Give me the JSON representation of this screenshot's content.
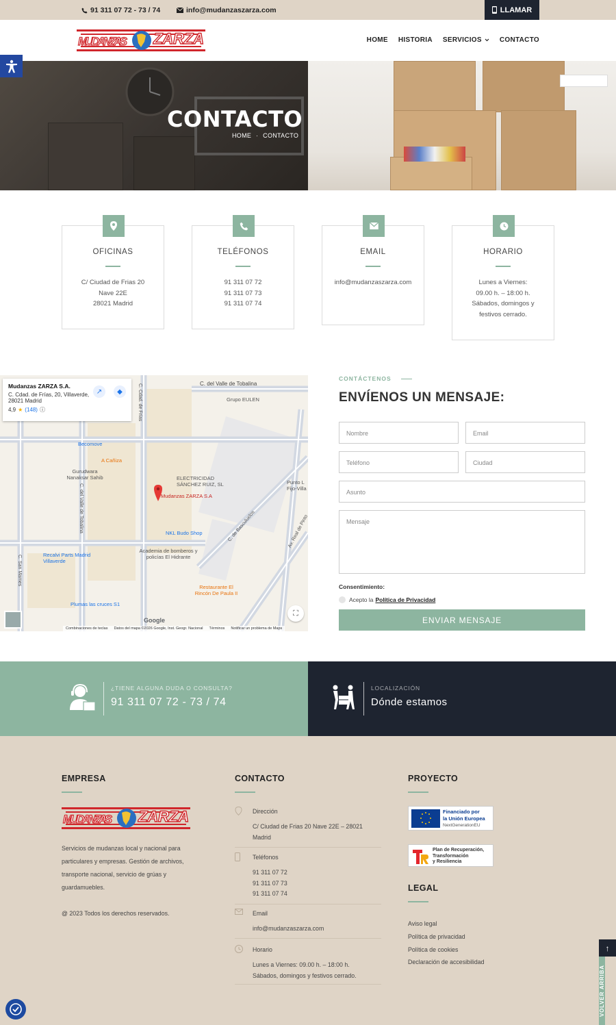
{
  "topbar": {
    "phone": "91 311 07 72 - 73 / 74",
    "email": "info@mudanzaszarza.com",
    "call_label": "LLAMAR"
  },
  "header": {
    "logo_text_left": "MUDANZAS",
    "logo_text_right": "ZARZA",
    "nav": [
      "HOME",
      "HISTORIA",
      "SERVICIOS",
      "CONTACTO"
    ]
  },
  "hero": {
    "title": "CONTACTO",
    "crumb_home": "HOME",
    "crumb_sep": "·",
    "crumb_current": "CONTACTO"
  },
  "cards": [
    {
      "icon": "location-icon",
      "title": "OFICINAS",
      "lines": [
        "C/ Ciudad de Frias 20",
        "Nave 22E",
        "28021 Madrid"
      ]
    },
    {
      "icon": "phone-icon",
      "title": "TELÉFONOS",
      "lines": [
        "91 311 07 72",
        "91 311 07 73",
        "91 311 07 74"
      ]
    },
    {
      "icon": "email-icon",
      "title": "EMAIL",
      "lines": [
        "info@mudanzaszarza.com"
      ]
    },
    {
      "icon": "clock-icon",
      "title": "HORARIO",
      "lines": [
        "Lunes a Viernes:",
        "09.00 h. – 18:00 h.",
        "Sábados, domingos y",
        "festivos cerrado."
      ]
    }
  ],
  "map": {
    "place_name": "Mudanzas ZARZA S.A.",
    "address_1": "C. Cdad. de Frías, 20, Villaverde,",
    "address_2": "28021 Madrid",
    "rating": "4,9",
    "reviews": "(148)",
    "labels": [
      "C. del Valle de Tobalina",
      "Grupo EULEN",
      "Becomove",
      "A Cañiza",
      "Gurudwara Nanaksar Sahib",
      "ELECTRICIDAD SÁNCHEZ RUIZ, SL",
      "Mudanzas ZARZA S.A",
      "NKL Budo Shop",
      "Academia de bomberos y policías El Hidrante",
      "Recalvi Parts Madrid Villaverde",
      "Restaurante El Rincón De Paula II",
      "Plumas las cruces S1",
      "C. San Mames",
      "C. Cdad. de Frías",
      "C. del Valle de Tobalina",
      "C. de Basculuelos",
      "Av. Real de Pinto",
      "Punto L Fijo-Villa"
    ],
    "footer": [
      "Combinaciones de teclas",
      "Datos del mapa ©2026 Google, Inst. Geogr. Nacional",
      "Términos",
      "Notificar un problema de Maps"
    ],
    "google": "Google"
  },
  "form": {
    "kicker": "CONTÁCTENOS",
    "title": "ENVÍENOS UN MENSAJE:",
    "placeholders": {
      "name": "Nombre",
      "email": "Email",
      "phone": "Teléfono",
      "city": "Ciudad",
      "subject": "Asunto",
      "message": "Mensaje"
    },
    "consent_label": "Consentimiento:",
    "accept_text": "Acepto la",
    "privacy_link": "Política de Privacidad",
    "submit": "ENVIAR MENSAJE"
  },
  "cta": {
    "left_kicker": "¿TIENE ALGUNA DUDA O CONSULTA?",
    "left_text": "91 311 07 72 - 73 / 74",
    "right_kicker": "LOCALIZACIÓN",
    "right_text": "Dónde estamos"
  },
  "footer": {
    "empresa_title": "EMPRESA",
    "empresa_text": "Servicios de mudanzas local y nacional para particulares y empresas.  Gestión de archivos, transporte nacional, servicio de grúas y guardamuebles.",
    "copyright": "@ 2023 Todos los derechos reservados.",
    "contacto_title": "CONTACTO",
    "contact_items": [
      {
        "label": "Dirección",
        "value": "C/ Ciudad de Frias 20 Nave 22E – 28021 Madrid"
      },
      {
        "label": "Teléfonos",
        "value": "91 311 07 72\n91 311 07 73\n91 311 07 74"
      },
      {
        "label": "Email",
        "value": "info@mudanzaszarza.com"
      },
      {
        "label": "Horario",
        "value": "Lunes a Viernes: 09.00 h. – 18:00 h.\nSábados, domingos y festivos cerrado."
      }
    ],
    "proyecto_title": "PROYECTO",
    "eu_line1": "Financiado por",
    "eu_line2": "la Unión Europea",
    "eu_line3": "NextGenerationEU",
    "prtr_line1": "Plan de Recuperación,",
    "prtr_line2": "Transformación",
    "prtr_line3": "y Resiliencia",
    "legal_title": "LEGAL",
    "legal_links": [
      "Aviso legal",
      "Política de privacidad",
      "Política de cookies",
      "Declaración de accesibilidad"
    ]
  },
  "totop": {
    "arrow": "↑",
    "label": "VOLVER ARRIBA"
  },
  "colors": {
    "accent": "#8db5a0",
    "dark": "#1e2430",
    "beige": "#dfd4c6",
    "brand_red": "#d0262b"
  }
}
